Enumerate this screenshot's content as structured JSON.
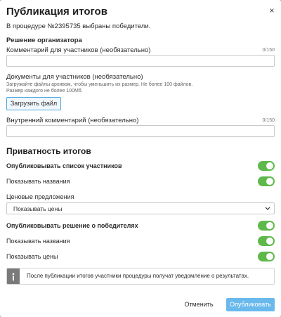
{
  "dialog": {
    "title": "Публикация итогов",
    "close_icon": "close-icon",
    "close_glyph": "×",
    "intro": "В процедуре №2395735 выбраны победители."
  },
  "organizer_decision": {
    "heading": "Решение организатора",
    "participant_comment": {
      "label": "Комментарий для участников (необязательно)",
      "counter": "0/150",
      "value": "",
      "placeholder": ""
    },
    "documents": {
      "label": "Документы для участников (необязательно)",
      "hint": "Загружайте файлы архивом, чтобы уменьшить их размер. Не более 100 файлов. Размер каждого не более 100Мб.",
      "upload_label": "Загрузить файл"
    },
    "internal_comment": {
      "label": "Внутренний комментарий (необязательно)",
      "counter": "0/150",
      "value": "",
      "placeholder": ""
    }
  },
  "privacy": {
    "heading": "Приватность итогов",
    "publish_participants": {
      "label": "Опубликовывать список участников",
      "on": true
    },
    "show_names_1": {
      "label": "Показывать названия",
      "on": true
    },
    "price_offers": {
      "label": "Ценовые предложения",
      "selected": "Показывать цены",
      "icon": "chevron-down-icon"
    },
    "publish_winners": {
      "label": "Опубликовывать решение о победителях",
      "on": true
    },
    "show_names_2": {
      "label": "Показывать названия",
      "on": true
    },
    "show_prices": {
      "label": "Показывать цены",
      "on": true
    }
  },
  "notice": {
    "icon": "info-icon",
    "text": "После публикации итогов участники процедуры получат уведомление о результатах."
  },
  "footer": {
    "cancel_label": "Отменить",
    "publish_label": "Опубликовать"
  },
  "colors": {
    "toggle_on": "#5fb94a",
    "primary_button": "#6ab9ec",
    "upload_border": "#49a7e2",
    "notice_side": "#7a7a7a"
  }
}
